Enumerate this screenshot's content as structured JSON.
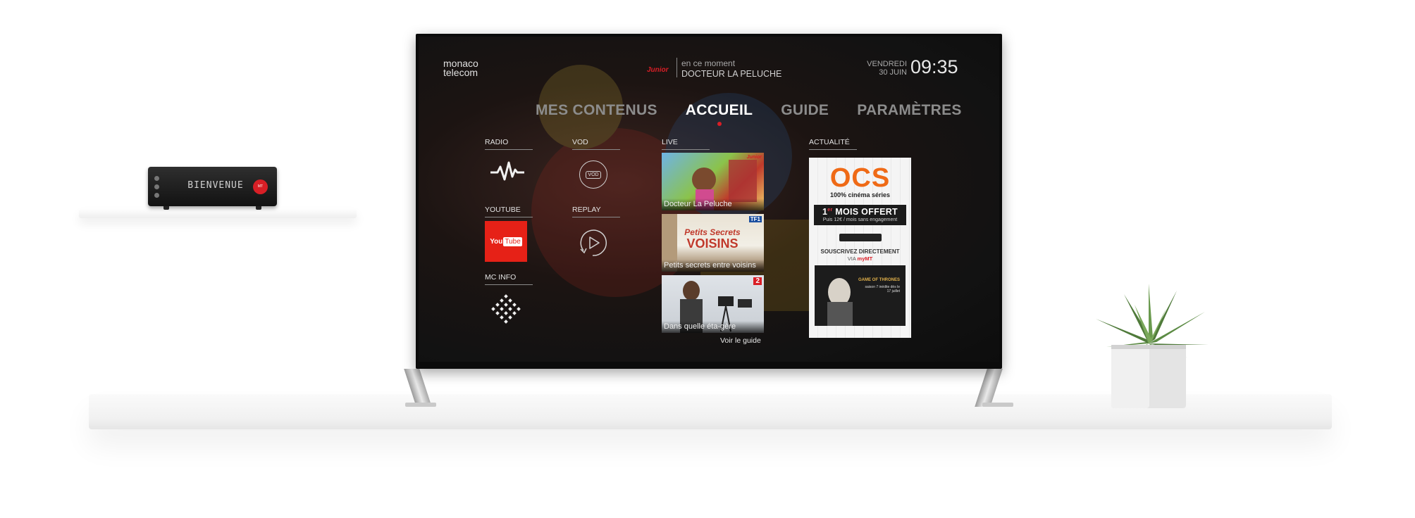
{
  "set_top_box": {
    "display_text": "BIENVENUE"
  },
  "tv": {
    "brand": {
      "line1": "monaco",
      "line2": "telecom"
    },
    "now_playing": {
      "channel": "Junior",
      "label": "en ce moment",
      "program": "DOCTEUR LA PELUCHE"
    },
    "datetime": {
      "day": "VENDREDI",
      "date": "30 JUIN",
      "time": "09:35"
    },
    "nav": {
      "items": [
        {
          "label": "MES CONTENUS",
          "active": false
        },
        {
          "label": "ACCUEIL",
          "active": true
        },
        {
          "label": "GUIDE",
          "active": false
        },
        {
          "label": "PARAMÈTRES",
          "active": false
        }
      ]
    },
    "sections": {
      "radio": {
        "label": "RADIO",
        "icon": "waveform-icon"
      },
      "vod": {
        "label": "VOD",
        "icon": "vod-icon",
        "icon_text": "VOD"
      },
      "youtube": {
        "label": "YOUTUBE",
        "logo_you": "You",
        "logo_tube": "Tube"
      },
      "replay": {
        "label": "REPLAY",
        "icon": "play-icon"
      },
      "mc_info": {
        "label": "MC INFO",
        "icon": "diamond-dots-icon"
      },
      "live": {
        "label": "LIVE",
        "cards": [
          {
            "title": "Docteur La Peluche",
            "channel": "Junior"
          },
          {
            "title": "Petits secrets entre voisins",
            "channel": "TF1"
          },
          {
            "title": "Dans quelle éta-gère",
            "channel": "2"
          }
        ],
        "guide_link": "Voir le guide"
      },
      "actualite": {
        "label": "ACTUALITÉ",
        "ad": {
          "brand": "OCS",
          "tagline": "100% cinéma séries",
          "offer_prefix": "1",
          "offer_sup": "er",
          "offer_main": " MOIS OFFERT",
          "offer_sub": "Puis 12€ / mois sans engagement",
          "subscribe": "SOUSCRIVEZ DIRECTEMENT",
          "via_prefix": "VIA ",
          "via_brand": "myMT",
          "tv_title": "GAME OF THRONES",
          "tv_sub": "saison 7 inédite dès le 17 juillet"
        }
      }
    }
  },
  "colors": {
    "accent_red": "#d91e26",
    "ocs_orange": "#ef6a16",
    "youtube_red": "#e62117"
  }
}
